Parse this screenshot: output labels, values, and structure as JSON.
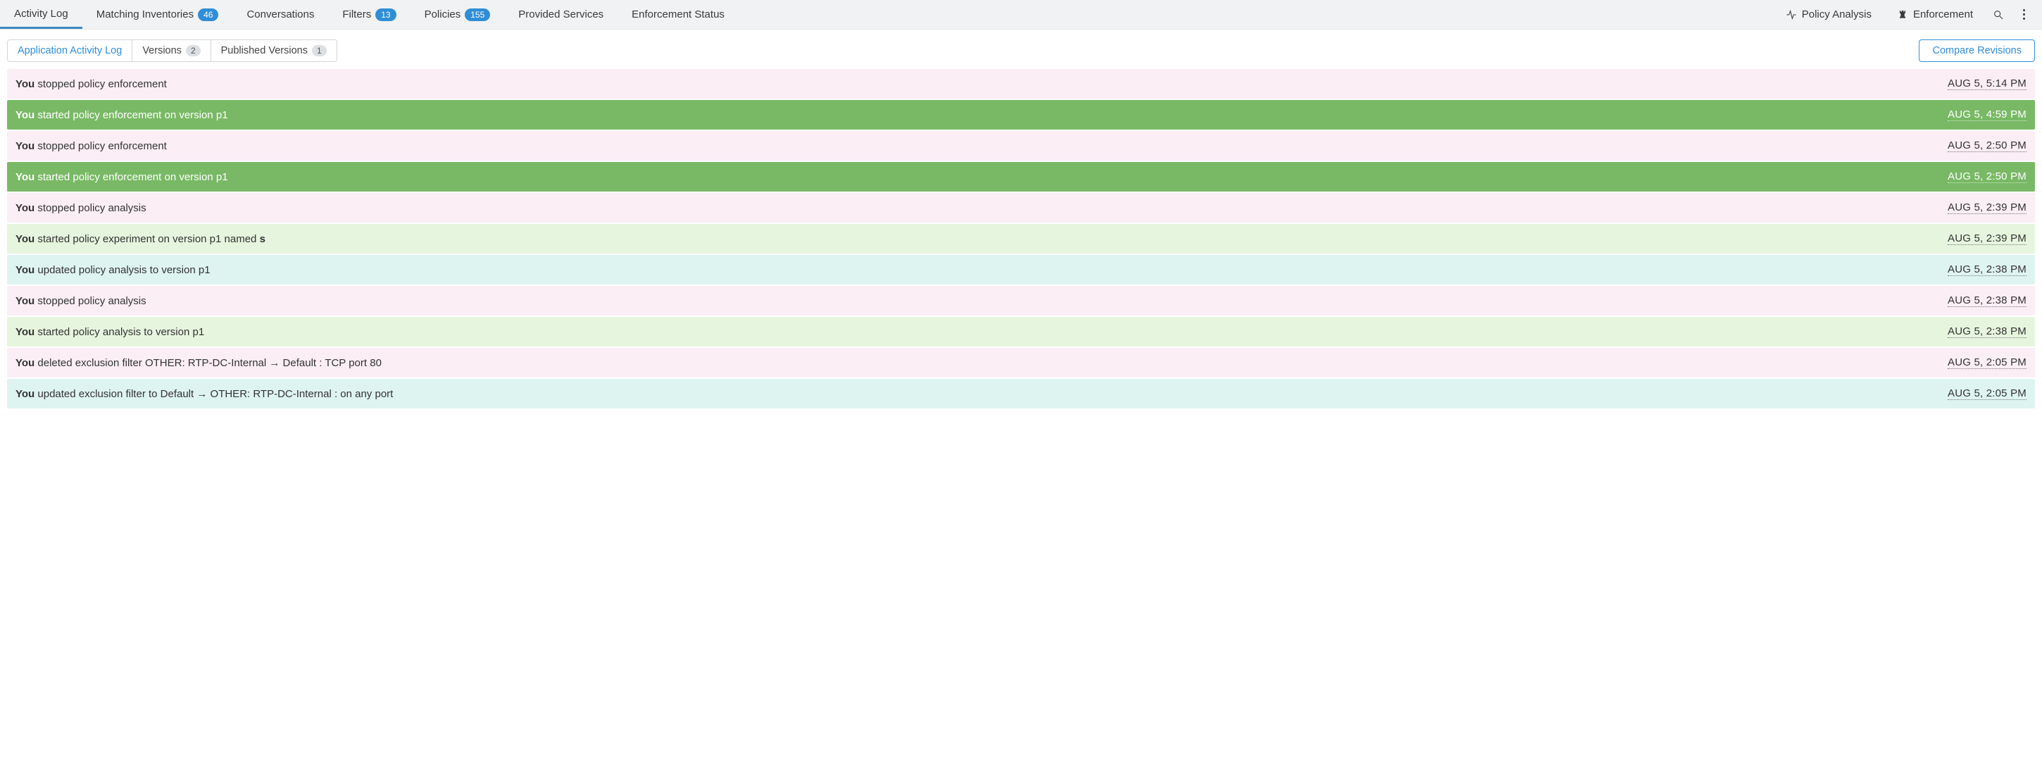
{
  "nav": {
    "tabs": [
      {
        "label": "Activity Log",
        "badge": null,
        "active": true
      },
      {
        "label": "Matching Inventories",
        "badge": "46",
        "active": false
      },
      {
        "label": "Conversations",
        "badge": null,
        "active": false
      },
      {
        "label": "Filters",
        "badge": "13",
        "active": false
      },
      {
        "label": "Policies",
        "badge": "155",
        "active": false
      },
      {
        "label": "Provided Services",
        "badge": null,
        "active": false
      },
      {
        "label": "Enforcement Status",
        "badge": null,
        "active": false
      }
    ],
    "right": {
      "policy_analysis": "Policy Analysis",
      "enforcement": "Enforcement"
    }
  },
  "subtabs": [
    {
      "label": "Application Activity Log",
      "badge": null,
      "active": true
    },
    {
      "label": "Versions",
      "badge": "2",
      "active": false
    },
    {
      "label": "Published Versions",
      "badge": "1",
      "active": false
    }
  ],
  "compare_btn": "Compare Revisions",
  "actor": "You",
  "log": [
    {
      "theme": "pink",
      "text": " stopped policy enforcement",
      "ts": "AUG 5, 5:14 PM"
    },
    {
      "theme": "green",
      "text": " started policy enforcement on version p1",
      "ts": "AUG 5, 4:59 PM"
    },
    {
      "theme": "pink",
      "text": " stopped policy enforcement",
      "ts": "AUG 5, 2:50 PM"
    },
    {
      "theme": "green",
      "text": " started policy enforcement on version p1",
      "ts": "AUG 5, 2:50 PM"
    },
    {
      "theme": "pink",
      "text": " stopped policy analysis",
      "ts": "AUG 5, 2:39 PM"
    },
    {
      "theme": "lgreen",
      "prefix": " started policy experiment on version p1 named ",
      "suffix_bold": "s",
      "ts": "AUG 5, 2:39 PM"
    },
    {
      "theme": "cyan",
      "text": " updated policy analysis to version p1",
      "ts": "AUG 5, 2:38 PM"
    },
    {
      "theme": "pink",
      "text": " stopped policy analysis",
      "ts": "AUG 5, 2:38 PM"
    },
    {
      "theme": "lgreen",
      "text": " started policy analysis to version p1",
      "ts": "AUG 5, 2:38 PM"
    },
    {
      "theme": "pink",
      "text": " deleted exclusion filter  OTHER: RTP-DC-Internal → Default : TCP port 80",
      "ts": "AUG 5, 2:05 PM"
    },
    {
      "theme": "cyan",
      "text": " updated exclusion filter to  Default → OTHER: RTP-DC-Internal : on any port",
      "ts": "AUG 5, 2:05 PM"
    }
  ]
}
